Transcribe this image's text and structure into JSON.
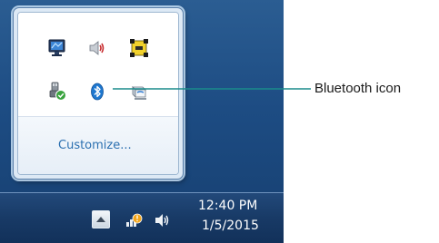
{
  "tray_popup": {
    "customize_label": "Customize...",
    "icons": [
      {
        "name": "network-icon"
      },
      {
        "name": "speaker-volume-icon"
      },
      {
        "name": "app-tray-icon"
      },
      {
        "name": "safely-remove-hardware-icon"
      },
      {
        "name": "bluetooth-icon"
      },
      {
        "name": "display-adapter-icon"
      }
    ]
  },
  "taskbar": {
    "clock_time": "12:40 PM",
    "clock_date": "1/5/2015",
    "icons": [
      {
        "name": "show-hidden-icons-button"
      },
      {
        "name": "network-warning-icon"
      },
      {
        "name": "volume-icon"
      }
    ]
  },
  "callout": {
    "label": "Bluetooth icon"
  },
  "colors": {
    "desktop_blue": "#1d4c83",
    "link_blue": "#2a6fb0",
    "bluetooth_blue": "#1e78d0"
  }
}
